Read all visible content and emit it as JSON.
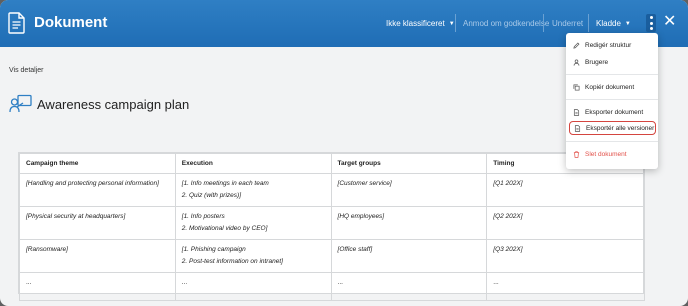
{
  "header": {
    "title": "Dokument",
    "classification_label": "Ikke klassificeret",
    "request_approval_label": "Anmod om godkendelse",
    "notified_label": "Underret",
    "status_label": "Kladde"
  },
  "body": {
    "details_link": "Vis detaljer",
    "page_title": "Awareness campaign plan"
  },
  "table": {
    "headers": [
      "Campaign theme",
      "Execution",
      "Target groups",
      "Timing"
    ],
    "rows": [
      [
        "[Handling and protecting personal information]",
        "[1. Info meetings in each team",
        "2. Quiz (with prizes)]",
        "[Customer service]",
        "[Q1 202X]"
      ],
      [
        "[Physical security at headquarters]",
        "[1. Info posters",
        "2. Motivational video by CEO]",
        "[HQ employees]",
        "[Q2 202X]"
      ],
      [
        "[Ransomware]",
        "[1. Phishing campaign",
        "2. Post-test information on intranet]",
        "[Office staff]",
        "[Q3 202X]"
      ],
      [
        "...",
        "...",
        "",
        "...",
        "..."
      ]
    ]
  },
  "menu": {
    "items": [
      {
        "label": "Redigér struktur",
        "icon": "pencil-icon"
      },
      {
        "label": "Brugere",
        "icon": "user-icon"
      },
      {
        "label": "Kopiér dokument",
        "icon": "copy-icon"
      },
      {
        "label": "Eksporter dokument",
        "icon": "document-icon"
      },
      {
        "label": "Eksportér alle versioner",
        "icon": "document-icon"
      },
      {
        "label": "Slet dokument",
        "icon": "trash-icon"
      }
    ]
  },
  "colors": {
    "header": "#1f6db5",
    "highlight": "#d4453f",
    "danger": "#e2514a"
  }
}
